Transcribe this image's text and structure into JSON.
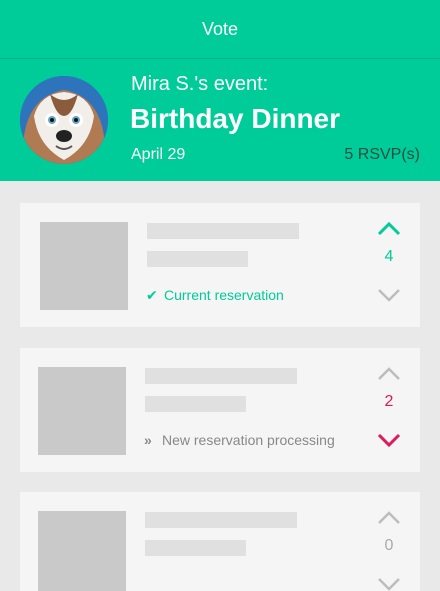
{
  "topbar": {
    "title": "Vote"
  },
  "event": {
    "host_line": "Mira S.'s event:",
    "title": "Birthday Dinner",
    "date": "April 29",
    "rsvp": "5 RSVP(s)"
  },
  "colors": {
    "brand": "#00cc99",
    "upvoted": "#00cc99",
    "downvoted": "#e0195a",
    "neutral": "#bdbdbd"
  },
  "cards": [
    {
      "votes": "4",
      "vote_state": "up",
      "status_icon": "check-icon",
      "status": "Current reservation"
    },
    {
      "votes": "2",
      "vote_state": "down",
      "status_icon": "double-chevron-right-icon",
      "status": "New reservation processing"
    },
    {
      "votes": "0",
      "vote_state": "none",
      "status_icon": "",
      "status": ""
    }
  ]
}
